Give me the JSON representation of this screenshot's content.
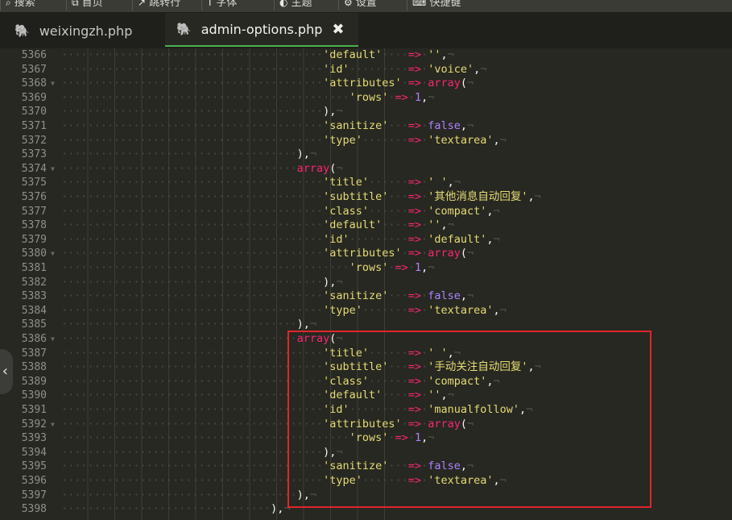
{
  "menubar": {
    "items": [
      {
        "icon": "search-icon",
        "label": "搜索"
      },
      {
        "icon": "preview-icon",
        "label": "首页"
      },
      {
        "icon": "jump-icon",
        "label": "跳转行"
      },
      {
        "icon": "font-icon",
        "label": "字体"
      },
      {
        "icon": "theme-icon",
        "label": "主题"
      },
      {
        "icon": "settings-icon",
        "label": "设置"
      },
      {
        "icon": "keyboard-icon",
        "label": "快捷键"
      }
    ]
  },
  "tabs": [
    {
      "label": "weixingzh.php",
      "icon": "php-elephant-icon",
      "active": false
    },
    {
      "label": "admin-options.php",
      "icon": "php-elephant-icon",
      "active": true,
      "close": "✖"
    }
  ],
  "editor": {
    "line_numbers": [
      "5366",
      "5367",
      "5368",
      "5369",
      "5370",
      "5371",
      "5372",
      "5373",
      "5374",
      "5375",
      "5376",
      "5377",
      "5378",
      "5379",
      "5380",
      "5381",
      "5382",
      "5383",
      "5384",
      "5385",
      "5386",
      "5387",
      "5388",
      "5389",
      "5390",
      "5391",
      "5392",
      "5393",
      "5394",
      "5395",
      "5396",
      "5397",
      "5398"
    ],
    "fold_markers": [
      "5368",
      "5374",
      "5380",
      "5386",
      "5392"
    ],
    "lines": [
      "                                        'default'    => '',",
      "                                        'id'         => 'voice',",
      "                                        'attributes' => array(",
      "                                            'rows' => 1,",
      "                                        ),",
      "                                        'sanitize'   => false,",
      "                                        'type'       => 'textarea',",
      "                                    ),",
      "                                    array(",
      "                                        'title'      => ' ',",
      "                                        'subtitle'   => '其他消息自动回复',",
      "                                        'class'      => 'compact',",
      "                                        'default'    => '',",
      "                                        'id'         => 'default',",
      "                                        'attributes' => array(",
      "                                            'rows' => 1,",
      "                                        ),",
      "                                        'sanitize'   => false,",
      "                                        'type'       => 'textarea',",
      "                                    ),",
      "                                    array(",
      "                                        'title'      => ' ',",
      "                                        'subtitle'   => '手动关注自动回复',",
      "                                        'class'      => 'compact',",
      "                                        'default'    => '',",
      "                                        'id'         => 'manualfollow',",
      "                                        'attributes' => array(",
      "                                            'rows' => 1,",
      "                                        ),",
      "                                        'sanitize'   => false,",
      "                                        'type'       => 'textarea',",
      "                                    ),",
      "                                ),"
    ]
  },
  "colors": {
    "background": "#272822",
    "string": "#e6db74",
    "keyword": "#f92672",
    "constant": "#ae81ff",
    "highlight_box": "#e0262c",
    "active_tab_underline": "#4caf50"
  }
}
